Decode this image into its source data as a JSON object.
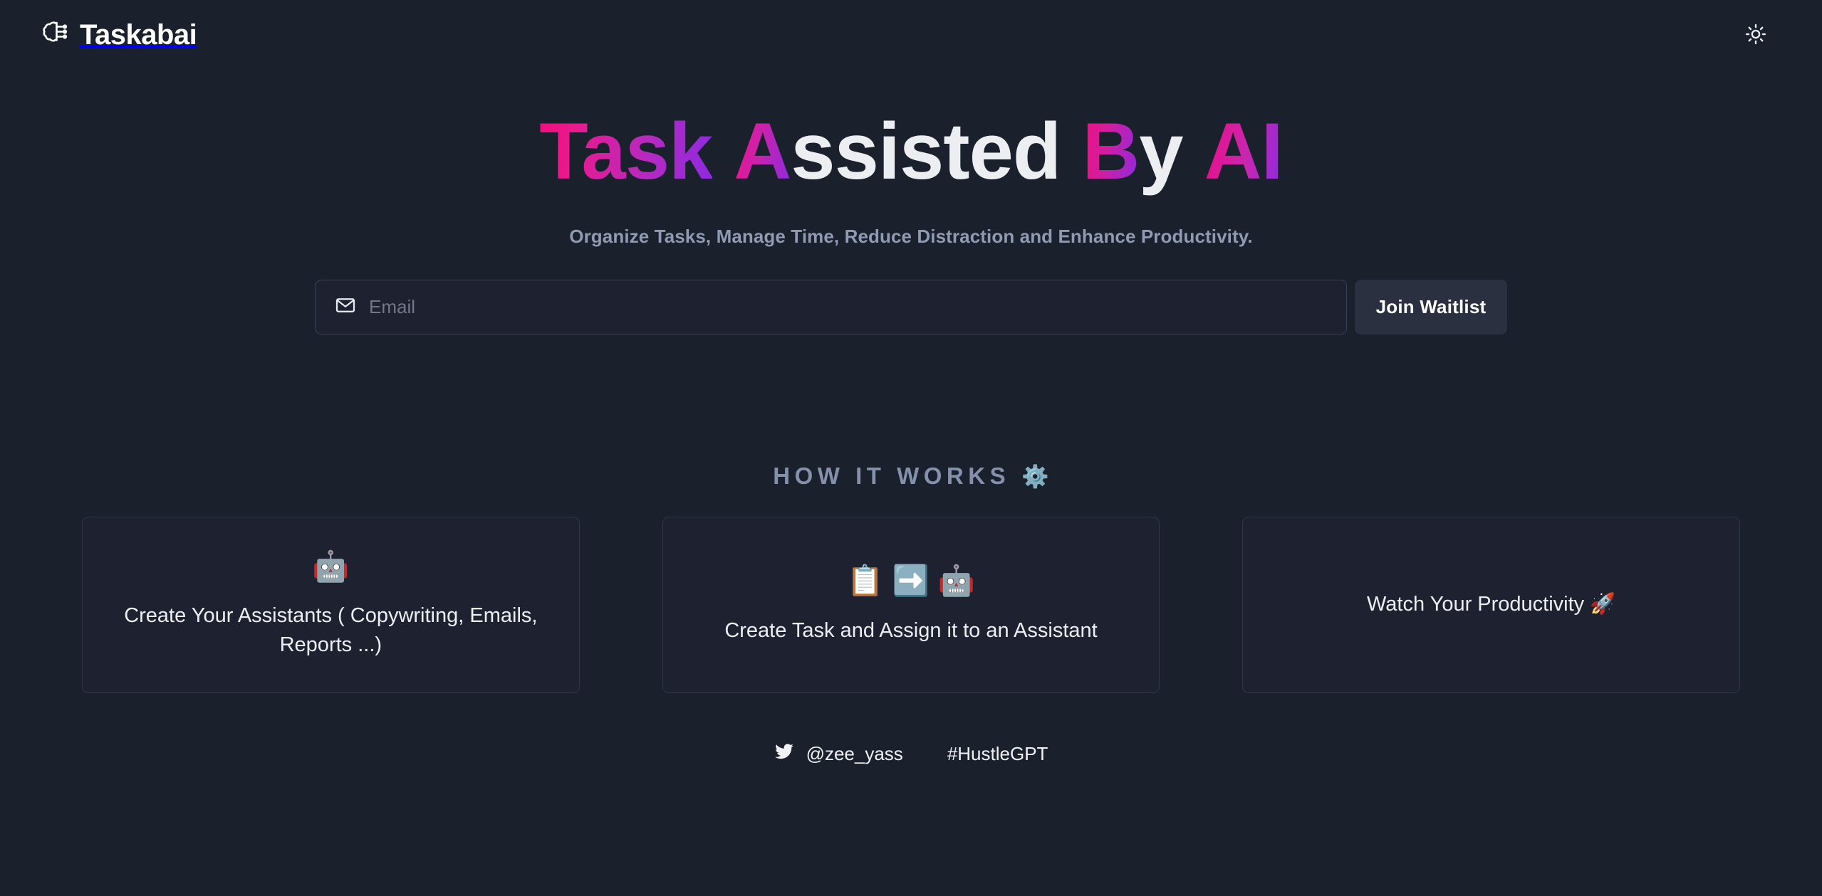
{
  "theme": {
    "background": "#1b202d",
    "surface": "#1e2230",
    "border": "#303647",
    "accent_pink": "#f20d7f",
    "accent_purple": "#8a2be2",
    "muted_text": "#8f9bb3"
  },
  "header": {
    "brand_name": "Taskabai",
    "brand_icon": "brain-circuit-icon",
    "theme_toggle_icon": "sun-icon"
  },
  "hero": {
    "headline_parts": [
      {
        "text": "Task",
        "style": "gradient"
      },
      {
        "text": " ",
        "style": "space"
      },
      {
        "text": "A",
        "style": "gradient"
      },
      {
        "text": "ssisted",
        "style": "white"
      },
      {
        "text": " ",
        "style": "space"
      },
      {
        "text": "B",
        "style": "gradient"
      },
      {
        "text": "y",
        "style": "white"
      },
      {
        "text": " ",
        "style": "space"
      },
      {
        "text": "AI",
        "style": "gradient"
      }
    ],
    "headline_plain": "Task Assisted By AI",
    "part_task": "Task",
    "part_a": "A",
    "part_ssisted": "ssisted",
    "part_b": "B",
    "part_y": "y",
    "part_ai": "AI",
    "subheadline": "Organize Tasks, Manage Time, Reduce Distraction and Enhance Productivity."
  },
  "signup": {
    "email_icon": "envelope-icon",
    "email_placeholder": "Email",
    "email_value": "",
    "submit_label": "Join Waitlist"
  },
  "how_it_works": {
    "title": "HOW IT WORKS",
    "title_icon": "gear-emoji",
    "title_emoji": "⚙️",
    "cards": [
      {
        "emoji": "🤖",
        "icons": [
          "robot-emoji"
        ],
        "text": "Create Your Assistants ( Copywriting, Emails, Reports ...)"
      },
      {
        "emoji": "📋 ➡️ 🤖",
        "icons": [
          "clipboard-emoji",
          "right-arrow-emoji",
          "robot-emoji"
        ],
        "text": "Create Task and Assign it to an Assistant"
      },
      {
        "emoji": "",
        "icons": [],
        "text": "Watch Your Productivity 🚀"
      }
    ]
  },
  "footer": {
    "twitter_icon": "twitter-bird-icon",
    "twitter_handle": "@zee_yass",
    "hashtag": "#HustleGPT"
  }
}
